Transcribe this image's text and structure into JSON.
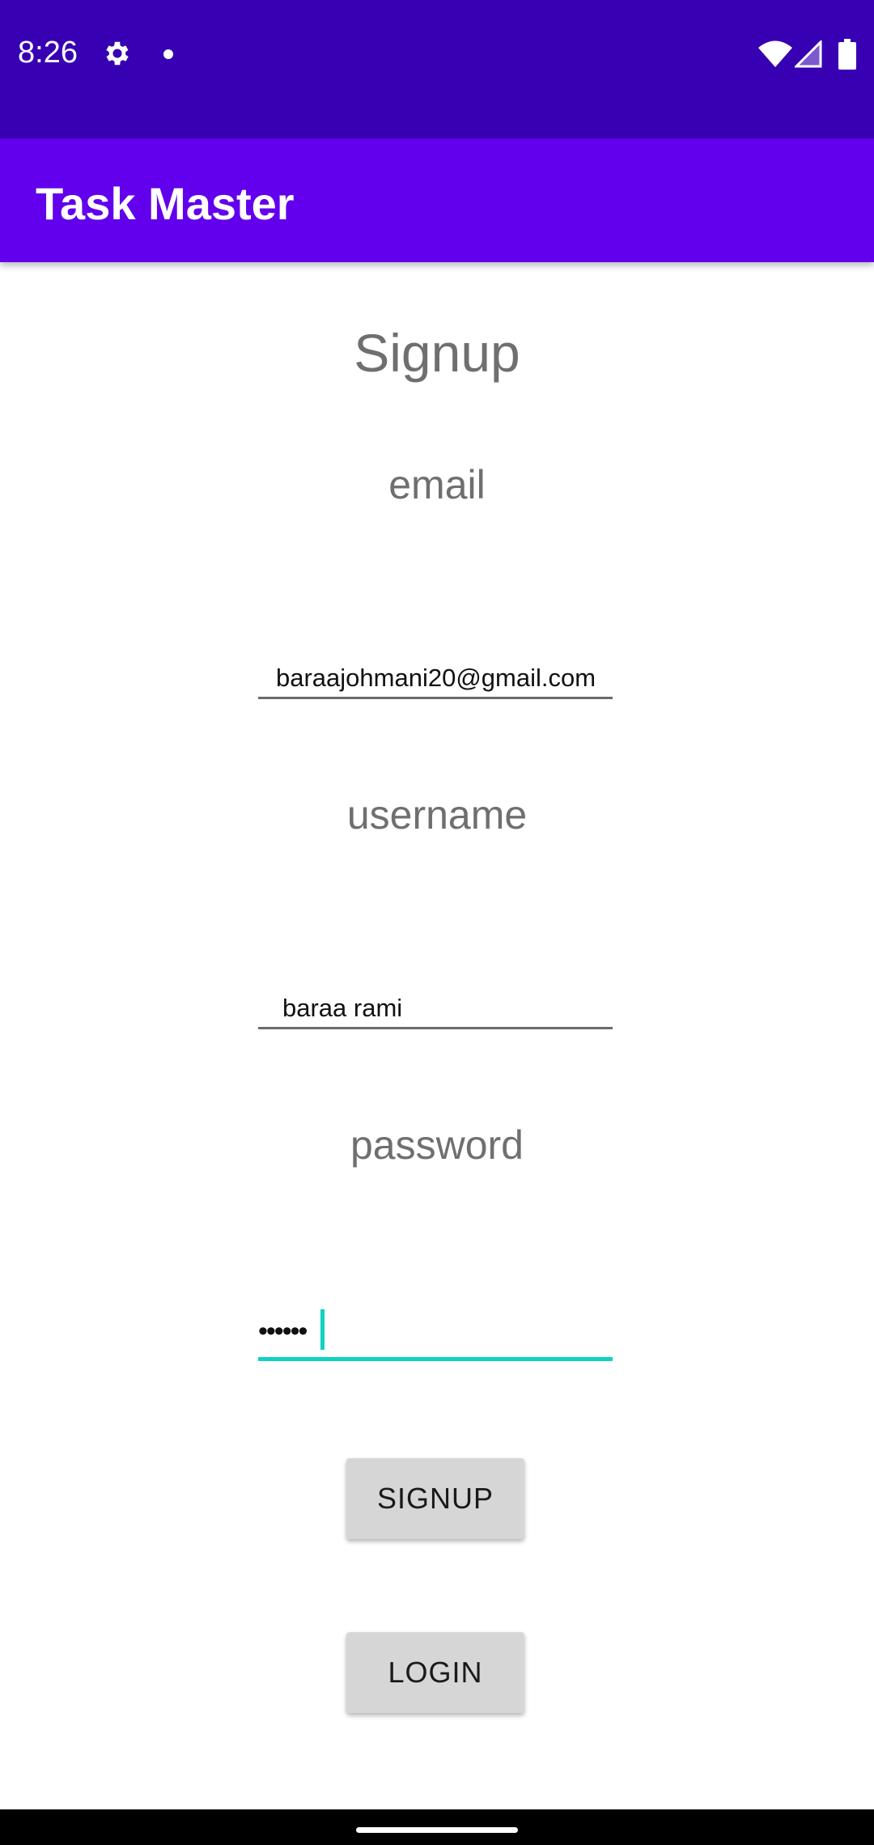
{
  "status_bar": {
    "time": "8:26",
    "icons": [
      "gear-icon",
      "notification-dot-icon",
      "wifi-icon",
      "signal-icon",
      "battery-icon"
    ]
  },
  "app_bar": {
    "title": "Task Master",
    "color": "#6200ee"
  },
  "form": {
    "heading": "Signup",
    "email_label": "email",
    "email_value": "baraajohmani20@gmail.com",
    "username_label": "username",
    "username_value": "baraa rami",
    "password_label": "password",
    "password_masked": "••••••",
    "focus_color": "#11d1c2"
  },
  "buttons": {
    "signup_label": "SIGNUP",
    "login_label": "LOGIN"
  },
  "colors": {
    "status_bar": "#3700b3",
    "app_bar": "#6200ee",
    "button": "#d6d6d6"
  }
}
